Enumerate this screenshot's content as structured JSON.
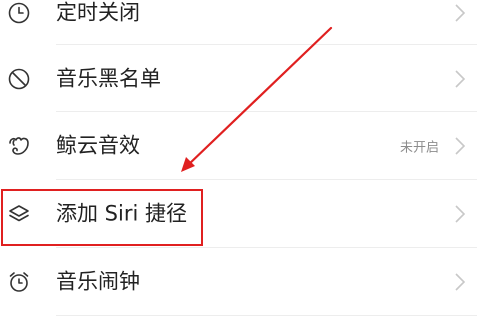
{
  "settings": {
    "items": [
      {
        "label": "定时关闭",
        "icon": "clock-icon",
        "value": ""
      },
      {
        "label": "音乐黑名单",
        "icon": "block-icon",
        "value": ""
      },
      {
        "label": "鲸云音效",
        "icon": "whale-icon",
        "value": "未开启"
      },
      {
        "label": "添加 Siri 捷径",
        "icon": "layers-icon",
        "value": ""
      },
      {
        "label": "音乐闹钟",
        "icon": "alarm-clock-icon",
        "value": ""
      }
    ]
  },
  "annotation": {
    "color": "#e02020",
    "highlighted_item": "添加 Siri 捷径"
  },
  "colors": {
    "text": "#222222",
    "secondary_text": "#8c8c8c",
    "icon": "#333333",
    "chevron": "#c8c8c8",
    "divider": "#ededed"
  }
}
